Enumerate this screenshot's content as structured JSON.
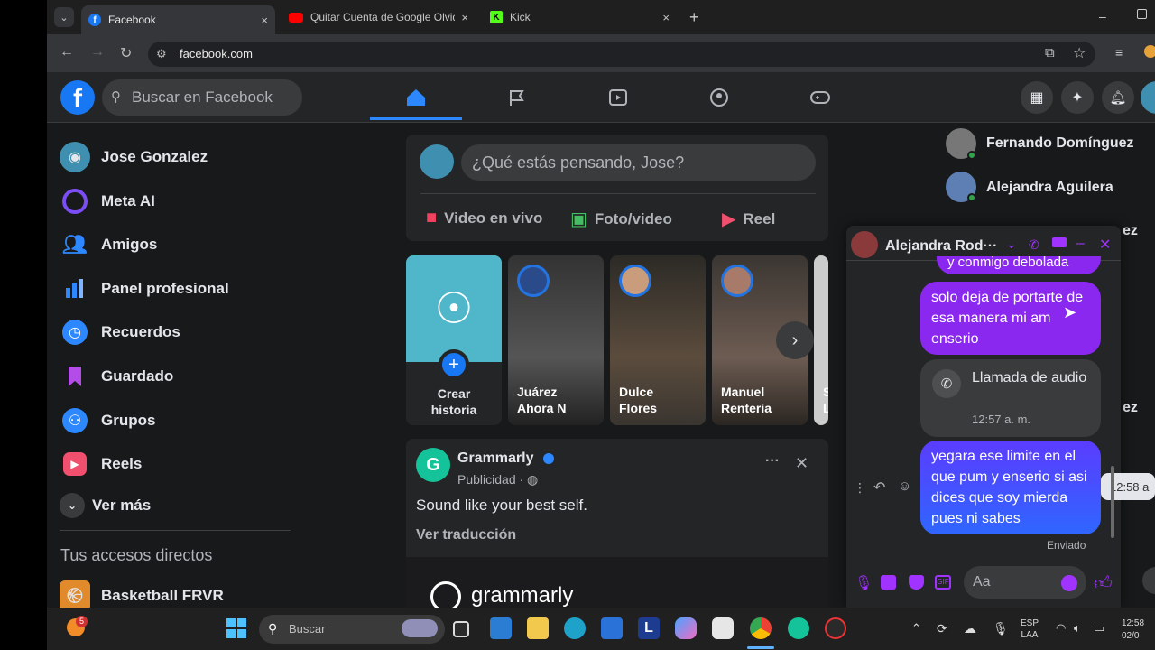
{
  "browser": {
    "tabs": [
      {
        "title": "Facebook",
        "icon": "facebook-icon"
      },
      {
        "title": "Quitar Cuenta de Google Olvid",
        "icon": "youtube-icon"
      },
      {
        "title": "Kick",
        "icon": "kick-icon"
      }
    ],
    "url": "facebook.com",
    "new_tab": "+",
    "close": "×"
  },
  "fb": {
    "logo": "f",
    "search_placeholder": "Buscar en Facebook",
    "sidebar": [
      {
        "label": "Jose Gonzalez",
        "icon": "profile-avatar-icon"
      },
      {
        "label": "Meta AI",
        "icon": "meta-ai-icon"
      },
      {
        "label": "Amigos",
        "icon": "friends-icon"
      },
      {
        "label": "Panel profesional",
        "icon": "dashboard-icon"
      },
      {
        "label": "Recuerdos",
        "icon": "memories-clock-icon"
      },
      {
        "label": "Guardado",
        "icon": "bookmark-icon"
      },
      {
        "label": "Grupos",
        "icon": "groups-icon"
      },
      {
        "label": "Reels",
        "icon": "reels-icon"
      }
    ],
    "ver_mas": "Ver más",
    "shortcuts_title": "Tus accesos directos",
    "shortcut_item": "Basketball FRVR",
    "composer_placeholder": "¿Qué estás pensando, Jose?",
    "composer_actions": [
      "Video en vivo",
      "Foto/video",
      "Reel"
    ],
    "stories": [
      {
        "line1": "Crear",
        "line2": "historia"
      },
      {
        "line1": "Juárez",
        "line2": "Ahora N"
      },
      {
        "line1": "Dulce",
        "line2": "Flores"
      },
      {
        "line1": "Manuel",
        "line2": "Renteria"
      },
      {
        "line1": "S",
        "line2": "L"
      }
    ],
    "post": {
      "author": "Grammarly",
      "meta": "Publicidad ·",
      "text": "Sound like your best self.",
      "translate": "Ver traducción",
      "brand": "grammarly",
      "more": "···",
      "close": "✕"
    },
    "contacts": [
      {
        "name": "Fernando Domínguez"
      },
      {
        "name": "Alejandra Aguilera"
      }
    ],
    "contacts_partial": [
      "ez",
      "ez"
    ]
  },
  "chat": {
    "title": "Alejandra Rod···",
    "top_partial": "y conmigo debolada",
    "msg1": "solo deja de portarte de esa manera mi am enserio",
    "call_title": "Llamada de audio",
    "call_time": "12:57 a. m.",
    "msg2": "yegara ese limite en el que pum y enserio si asi dices que soy mierda pues ni sabes",
    "hover_time": "12:58 a",
    "status": "Enviado",
    "input_placeholder": "Aa",
    "accent": "#a033ff",
    "bubble_color": "#7b2ff7",
    "bubble_color_2": "#3b5bff"
  },
  "taskbar": {
    "search": "Buscar",
    "lang1": "ESP",
    "lang2": "LAA",
    "time": "12:58",
    "date": "02/0",
    "badge": "5"
  }
}
